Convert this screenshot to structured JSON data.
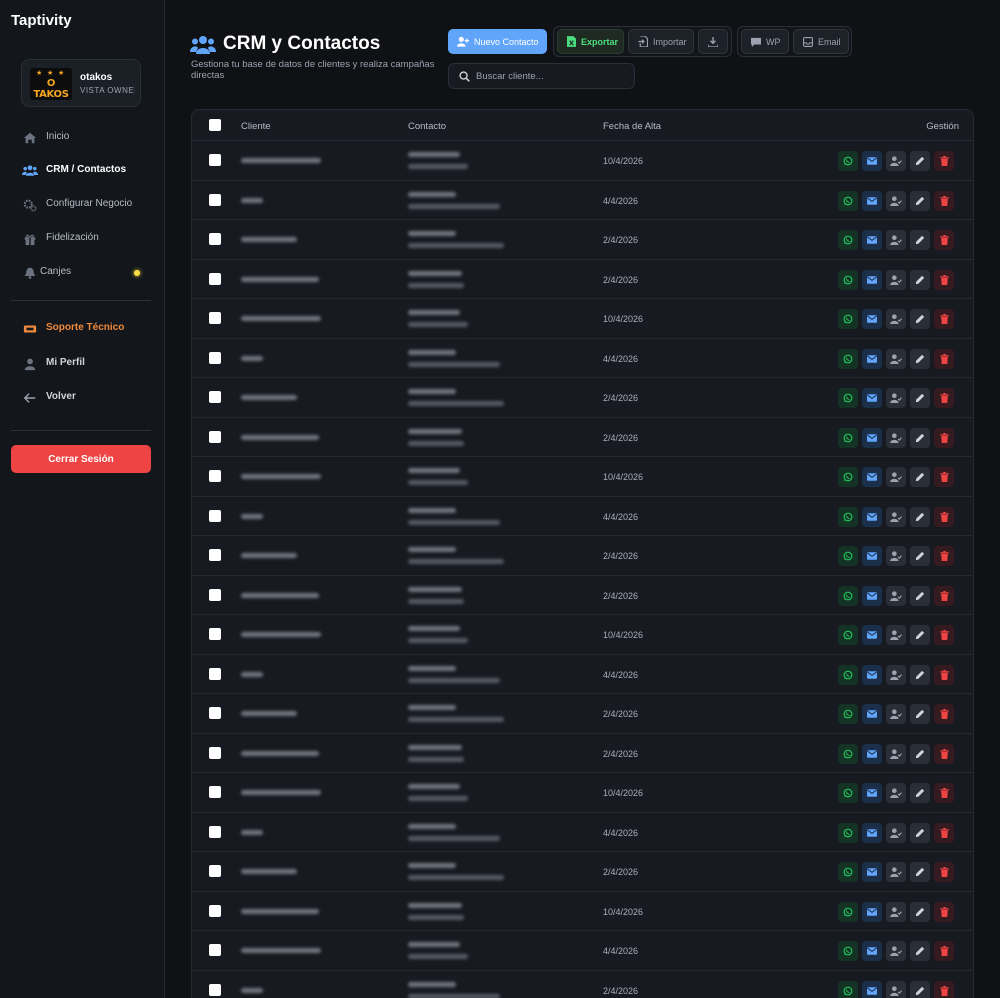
{
  "app": {
    "brand": "Taptivity"
  },
  "profile": {
    "name": "otakos",
    "role": "VISTA OWNER",
    "logo_text": "O TAKOS"
  },
  "sidebar": {
    "items": [
      {
        "label": "Inicio",
        "icon": "home-icon"
      },
      {
        "label": "CRM / Contactos",
        "icon": "users-icon",
        "active": true
      },
      {
        "label": "Configurar Negocio",
        "icon": "gear-icon"
      },
      {
        "label": "Fidelización",
        "icon": "gift-icon"
      },
      {
        "label": "Canjes",
        "icon": "bell-icon",
        "indicator_color": "#fde047"
      }
    ],
    "secondary": [
      {
        "label": "Soporte Técnico",
        "icon": "ticket-icon",
        "color": "#f08a3c"
      },
      {
        "label": "Mi Perfil",
        "icon": "user-icon"
      },
      {
        "label": "Volver",
        "icon": "arrow-left-icon"
      }
    ],
    "logout_label": "Cerrar Sesión"
  },
  "header": {
    "title": "CRM y Contactos",
    "subtitle": "Gestiona tu base de datos de clientes y realiza campañas directas",
    "buttons": {
      "new_contact": "Nuevo Contacto",
      "export": "Exportar",
      "import": "Importar",
      "wp": "WP",
      "email": "Email"
    },
    "search_placeholder": "Buscar cliente..."
  },
  "table": {
    "columns": [
      "Cliente",
      "Contacto",
      "Fecha de Alta",
      "Gestión"
    ],
    "rows": [
      {
        "date": "10/4/2026"
      },
      {
        "date": "4/4/2026"
      },
      {
        "date": "2/4/2026"
      },
      {
        "date": "2/4/2026"
      },
      {
        "date": "10/4/2026"
      },
      {
        "date": "4/4/2026"
      },
      {
        "date": "2/4/2026"
      },
      {
        "date": "2/4/2026"
      },
      {
        "date": "10/4/2026"
      },
      {
        "date": "4/4/2026"
      },
      {
        "date": "2/4/2026"
      },
      {
        "date": "2/4/2026"
      },
      {
        "date": "10/4/2026"
      },
      {
        "date": "4/4/2026"
      },
      {
        "date": "2/4/2026"
      },
      {
        "date": "2/4/2026"
      },
      {
        "date": "10/4/2026"
      },
      {
        "date": "4/4/2026"
      },
      {
        "date": "2/4/2026"
      },
      {
        "date": "10/4/2026"
      },
      {
        "date": "4/4/2026"
      },
      {
        "date": "2/4/2026"
      }
    ],
    "row_actions": [
      "whatsapp-icon",
      "mail-icon",
      "user-check-icon",
      "pencil-icon",
      "trash-icon"
    ]
  },
  "colors": {
    "accent": "#60a5fa",
    "danger": "#ef4444",
    "success": "#4ade80",
    "support": "#f08a3c"
  }
}
